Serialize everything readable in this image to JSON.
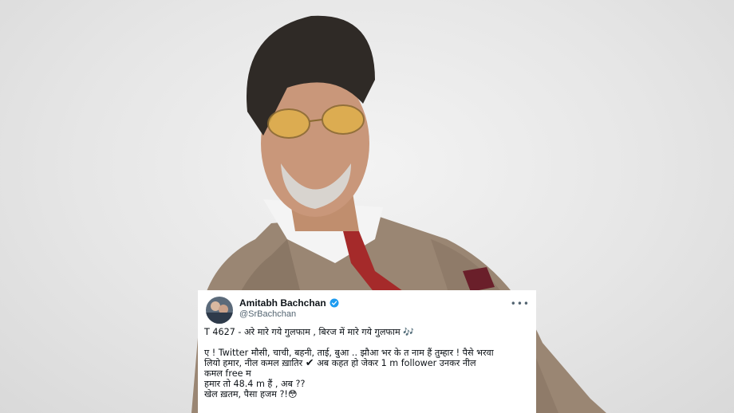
{
  "tweet": {
    "author_name": "Amitabh Bachchan",
    "handle": "@SrBachchan",
    "more_icon": "more-horizontal-icon",
    "verified_icon": "verified-badge-icon",
    "line1": "T 4627 - अरे मारे गये गुलफाम  , बिरज में मारे गये गुलफाम ",
    "line1_emoji": "🎶",
    "line2a": "ए ! Twitter मौसी, चाची, बहनी, ताई, बुआ .. झौआ भर के त नाम हैं तुम्हार  ! पैसे भरवा",
    "line2b": "लियो हमार, नील कमल ख़ातिर ",
    "line2b_check": "✔",
    "line2b_rest": " अब कहत हो  जेकर 1 m follower  उनकर नील",
    "line2c": "कमल free म",
    "line3": "हमार तो 48.4 m हैं  , अब  ??",
    "line4": "खेल ख़तम, पैसा हजम ?!",
    "line4_emoji": "😳"
  },
  "colors": {
    "background": "#e9e9e9",
    "verified": "#1d9bf0",
    "text": "#0f1419",
    "muted": "#536471"
  }
}
